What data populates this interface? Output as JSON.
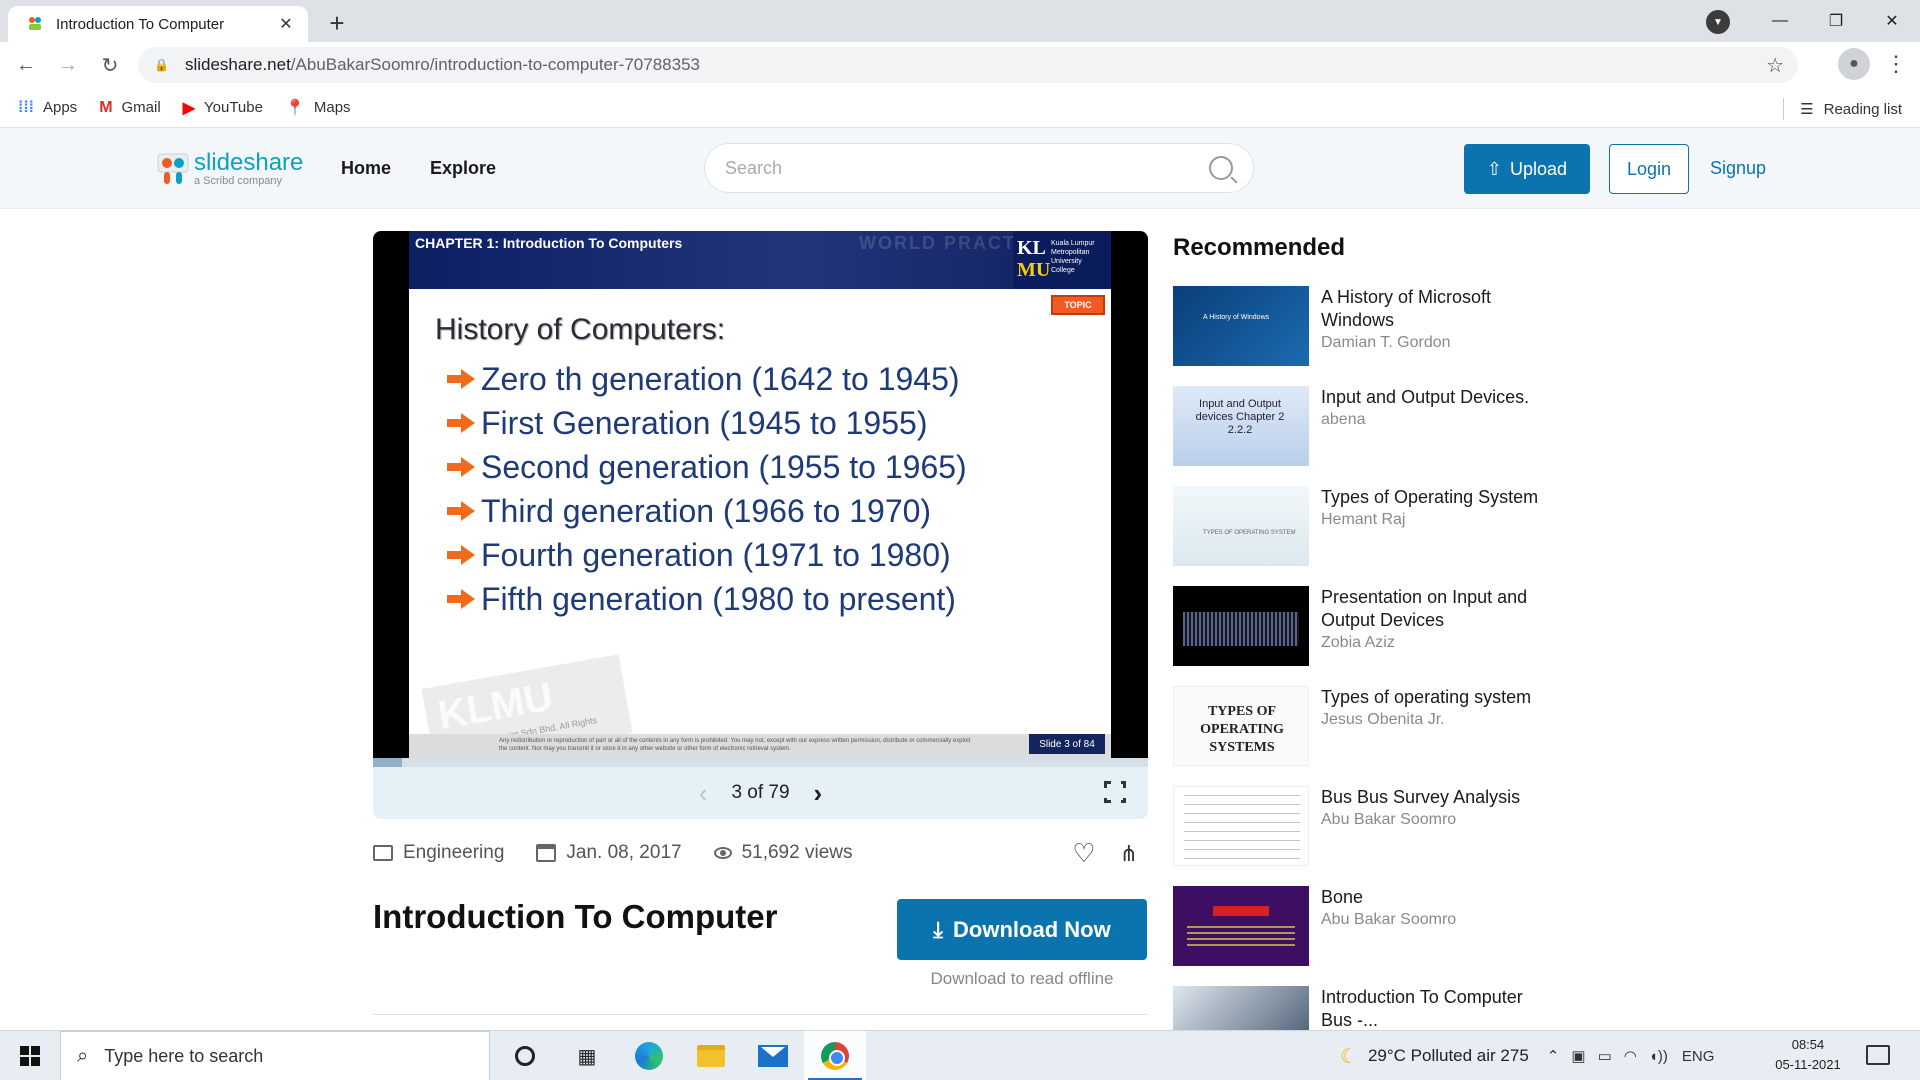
{
  "browser": {
    "tab_title": "Introduction To Computer",
    "url_host": "slideshare.net",
    "url_path": "/AbuBakarSoomro/introduction-to-computer-70788353",
    "bookmarks": [
      {
        "label": "Apps",
        "icon": "apps-grid-icon",
        "color": "#4285f4"
      },
      {
        "label": "Gmail",
        "icon": "gmail-icon",
        "color": "#d93025"
      },
      {
        "label": "YouTube",
        "icon": "youtube-icon",
        "color": "#ff0000"
      },
      {
        "label": "Maps",
        "icon": "maps-icon",
        "color": "#34a853"
      }
    ],
    "reading_list": "Reading list"
  },
  "site": {
    "logo_text": "slideshare",
    "logo_sub": "a Scribd company",
    "nav": [
      "Home",
      "Explore"
    ],
    "search_placeholder": "Search",
    "upload_label": "Upload",
    "login_label": "Login",
    "signup_label": "Signup",
    "accent_color": "#0b74ae"
  },
  "viewer": {
    "slide": {
      "chapter": "CHAPTER 1: Introduction To Computers",
      "watermark": "WORLD PRACTICE",
      "logo_letters": [
        "KL",
        "MU"
      ],
      "logo_lines": [
        "Kuala Lumpur",
        "Metropolitan",
        "University",
        "College"
      ],
      "topic_tag": "TOPIC",
      "heading": "History of Computers:",
      "items": [
        "Zero th generation (1642 to 1945)",
        "First Generation (1945 to 1955)",
        "Second generation (1955 to 1965)",
        "Third generation (1966 to 1970)",
        "Fourth generation (1971 to 1980)",
        "Fifth generation (1980 to present)"
      ],
      "footer_watermark": "KLMU",
      "footer_copyright": "2017 © Cosmopoint Sdn Bhd. All Rights Reserved.",
      "footer_fine_print": "Any redistribution or reproduction of part or all of the contents in any form is prohibited. You may not, except with our express written permission, distribute or commercially exploit the content. Nor may you transmit it or store it in any other website or other form of electronic retrieval system.",
      "slide_label": "Slide 3 of 84"
    },
    "current_page": 3,
    "total_pages": 79,
    "counter_text": "3 of 79"
  },
  "meta": {
    "category": "Engineering",
    "date": "Jan. 08, 2017",
    "views": "51,692 views"
  },
  "document": {
    "title": "Introduction To Computer",
    "download_label": "Download Now",
    "download_note": "Download to read offline"
  },
  "recommended": {
    "heading": "Recommended",
    "items": [
      {
        "title": "A History of Microsoft Windows",
        "author": "Damian T. Gordon",
        "thumb_text": "A History of Windows"
      },
      {
        "title": "Input and Output Devices.",
        "author": "abena",
        "thumb_text": "Input and Output devices Chapter 2 2.2.2"
      },
      {
        "title": "Types of Operating System",
        "author": "Hemant Raj",
        "thumb_text": "TYPES OF OPERATING SYSTEM"
      },
      {
        "title": "Presentation on Input and Output Devices",
        "author": "Zobia Aziz",
        "thumb_text": ""
      },
      {
        "title": "Types of operating system",
        "author": "Jesus Obenita Jr.",
        "thumb_text": "TYPES OF OPERATING SYSTEMS"
      },
      {
        "title": "Bus Bus Survey Analysis",
        "author": "Abu Bakar Soomro",
        "thumb_text": ""
      },
      {
        "title": "Bone",
        "author": "Abu Bakar Soomro",
        "thumb_text": "BONE"
      },
      {
        "title": "Introduction To Computer Bus -...",
        "author": "",
        "thumb_text": ""
      }
    ]
  },
  "taskbar": {
    "search_placeholder": "Type here to search",
    "weather": "29°C  Polluted air 275",
    "language": "ENG",
    "time": "08:54",
    "date": "05-11-2021"
  }
}
